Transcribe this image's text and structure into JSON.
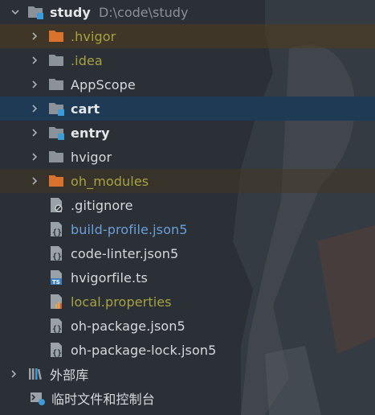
{
  "project": {
    "name": "study",
    "path": "D:\\code\\study"
  },
  "items": [
    {
      "label": ".hvigor",
      "icon": "folder-excluded-icon"
    },
    {
      "label": ".idea",
      "icon": "folder-icon"
    },
    {
      "label": "AppScope",
      "icon": "folder-icon"
    },
    {
      "label": "cart",
      "icon": "module-folder-icon"
    },
    {
      "label": "entry",
      "icon": "module-folder-icon"
    },
    {
      "label": "hvigor",
      "icon": "folder-icon"
    },
    {
      "label": "oh_modules",
      "icon": "folder-excluded-icon"
    },
    {
      "label": ".gitignore",
      "icon": "gitignore-file-icon"
    },
    {
      "label": "build-profile.json5",
      "icon": "json-file-icon"
    },
    {
      "label": "code-linter.json5",
      "icon": "json-file-icon"
    },
    {
      "label": "hvigorfile.ts",
      "icon": "typescript-file-icon"
    },
    {
      "label": "local.properties",
      "icon": "properties-file-icon"
    },
    {
      "label": "oh-package.json5",
      "icon": "json-file-icon"
    },
    {
      "label": "oh-package-lock.json5",
      "icon": "json-file-icon"
    }
  ],
  "external_libraries": {
    "label": "外部库",
    "icon": "libraries-icon"
  },
  "scratches": {
    "label": "临时文件和控制台",
    "icon": "scratches-icon"
  },
  "colors": {
    "excluded_text": "#a7a241",
    "modified_text": "#6a9fd8",
    "selection_bg": "#1e3a55",
    "excluded_folder": "#d9722c",
    "module_badge": "#3d9bd8"
  }
}
